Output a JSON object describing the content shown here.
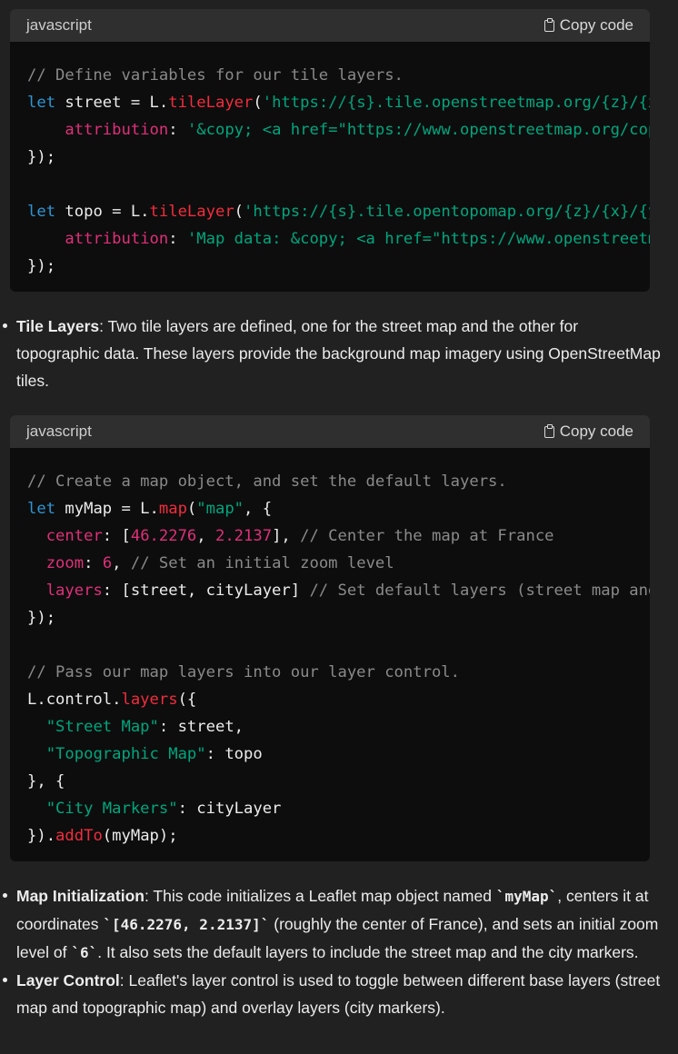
{
  "block1": {
    "language": "javascript",
    "copy_label": "Copy code",
    "lines": [
      [
        [
          "c-com",
          "// Define variables for our tile layers."
        ]
      ],
      [
        [
          "c-kw",
          "let"
        ],
        [
          "c-pl",
          " street = L."
        ],
        [
          "c-fn",
          "tileLayer"
        ],
        [
          "c-pl",
          "("
        ],
        [
          "c-str",
          "'https://{s}.tile.openstreetmap.org/{z}/{x}/{y}.png'"
        ],
        [
          "c-pl",
          ", {"
        ]
      ],
      [
        [
          "c-pl",
          "    "
        ],
        [
          "c-prop",
          "attribution"
        ],
        [
          "c-pl",
          ": "
        ],
        [
          "c-str",
          "'&copy; <a href=\"https://www.openstreetmap.org/copyright\">OpenStreetMap</a>'"
        ]
      ],
      [
        [
          "c-pl",
          "});"
        ]
      ],
      [
        [
          "c-pl",
          ""
        ]
      ],
      [
        [
          "c-kw",
          "let"
        ],
        [
          "c-pl",
          " topo = L."
        ],
        [
          "c-fn",
          "tileLayer"
        ],
        [
          "c-pl",
          "("
        ],
        [
          "c-str",
          "'https://{s}.tile.opentopomap.org/{z}/{x}/{y}.png'"
        ],
        [
          "c-pl",
          ", {"
        ]
      ],
      [
        [
          "c-pl",
          "    "
        ],
        [
          "c-prop",
          "attribution"
        ],
        [
          "c-pl",
          ": "
        ],
        [
          "c-str",
          "'Map data: &copy; <a href=\"https://www.openstreetmap.org/copyright\">'"
        ]
      ],
      [
        [
          "c-pl",
          "});"
        ]
      ]
    ]
  },
  "bullet1": {
    "term": "Tile Layers",
    "text": ": Two tile layers are defined, one for the street map and the other for topographic data. These layers provide the background map imagery using OpenStreetMap tiles."
  },
  "block2": {
    "language": "javascript",
    "copy_label": "Copy code",
    "lines": [
      [
        [
          "c-com",
          "// Create a map object, and set the default layers."
        ]
      ],
      [
        [
          "c-kw",
          "let"
        ],
        [
          "c-pl",
          " myMap = L."
        ],
        [
          "c-fn",
          "map"
        ],
        [
          "c-pl",
          "("
        ],
        [
          "c-str",
          "\"map\""
        ],
        [
          "c-pl",
          ", {"
        ]
      ],
      [
        [
          "c-pl",
          "  "
        ],
        [
          "c-prop",
          "center"
        ],
        [
          "c-pl",
          ": ["
        ],
        [
          "c-num",
          "46.2276"
        ],
        [
          "c-pl",
          ", "
        ],
        [
          "c-num",
          "2.2137"
        ],
        [
          "c-pl",
          "], "
        ],
        [
          "c-com",
          "// Center the map at France"
        ]
      ],
      [
        [
          "c-pl",
          "  "
        ],
        [
          "c-prop",
          "zoom"
        ],
        [
          "c-pl",
          ": "
        ],
        [
          "c-num",
          "6"
        ],
        [
          "c-pl",
          ", "
        ],
        [
          "c-com",
          "// Set an initial zoom level"
        ]
      ],
      [
        [
          "c-pl",
          "  "
        ],
        [
          "c-prop",
          "layers"
        ],
        [
          "c-pl",
          ": [street, cityLayer] "
        ],
        [
          "c-com",
          "// Set default layers (street map and city markers)"
        ]
      ],
      [
        [
          "c-pl",
          "});"
        ]
      ],
      [
        [
          "c-pl",
          ""
        ]
      ],
      [
        [
          "c-com",
          "// Pass our map layers into our layer control."
        ]
      ],
      [
        [
          "c-pl",
          "L.control."
        ],
        [
          "c-fn",
          "layers"
        ],
        [
          "c-pl",
          "({"
        ]
      ],
      [
        [
          "c-pl",
          "  "
        ],
        [
          "c-str",
          "\"Street Map\""
        ],
        [
          "c-pl",
          ": street,"
        ]
      ],
      [
        [
          "c-pl",
          "  "
        ],
        [
          "c-str",
          "\"Topographic Map\""
        ],
        [
          "c-pl",
          ": topo"
        ]
      ],
      [
        [
          "c-pl",
          "}, {"
        ]
      ],
      [
        [
          "c-pl",
          "  "
        ],
        [
          "c-str",
          "\"City Markers\""
        ],
        [
          "c-pl",
          ": cityLayer"
        ]
      ],
      [
        [
          "c-pl",
          "})."
        ],
        [
          "c-fn",
          "addTo"
        ],
        [
          "c-pl",
          "(myMap);"
        ]
      ]
    ]
  },
  "bullet2": {
    "term": "Map Initialization",
    "text_a": ": This code initializes a Leaflet map object named ",
    "code_a": "`myMap`",
    "text_b": ", centers it at coordinates ",
    "code_b": "`[46.2276, 2.2137]`",
    "text_c": " (roughly the center of France), and sets an initial zoom level of ",
    "code_c": "`6`",
    "text_d": ". It also sets the default layers to include the street map and the city markers."
  },
  "bullet3": {
    "term": "Layer Control",
    "text": ": Leaflet's layer control is used to toggle between different base layers (street map and topographic map) and overlay layers (city markers)."
  }
}
